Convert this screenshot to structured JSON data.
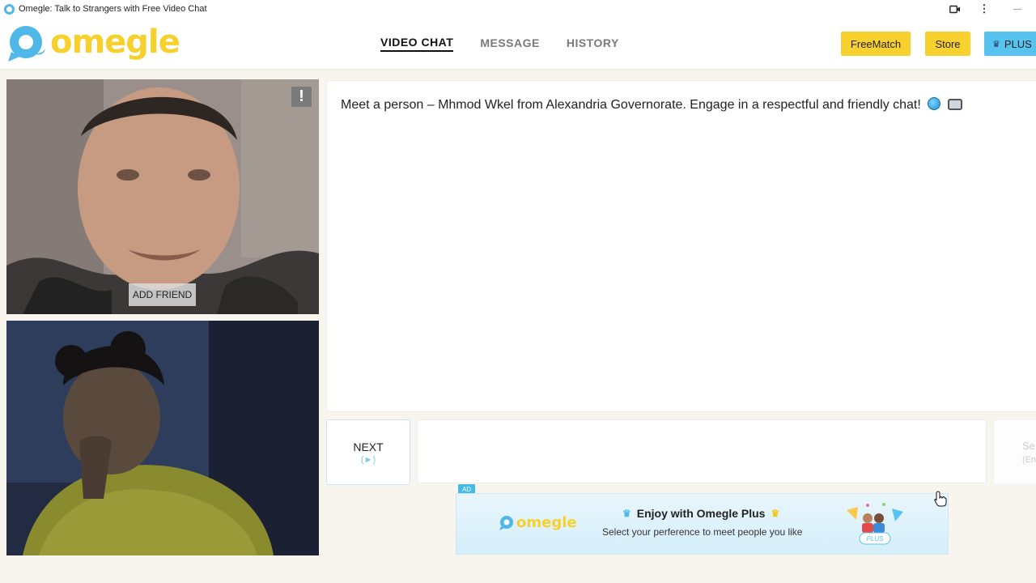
{
  "window": {
    "title": "Omegle: Talk to Strangers with Free Video Chat",
    "controls": {
      "camera": "camera-icon",
      "more": "⋮",
      "minimize": "—"
    }
  },
  "header": {
    "logo_text": "omegle",
    "nav": [
      {
        "label": "VIDEO CHAT",
        "active": true
      },
      {
        "label": "MESSAGE",
        "active": false
      },
      {
        "label": "HISTORY",
        "active": false
      }
    ],
    "freematch_label": "FreeMatch",
    "store_label": "Store",
    "plus_label": "PLUS",
    "plus_icon": "♛"
  },
  "video": {
    "remote": {
      "report_label": "!",
      "add_friend_label": "ADD FRIEND"
    }
  },
  "chat": {
    "intro_message": "Meet a person – Mhmod Wkel from Alexandria Governorate. Engage in a respectful and friendly chat!"
  },
  "controls": {
    "next_label": "NEXT",
    "next_hint": "(►)",
    "input_value": "",
    "send_label": "Se",
    "send_hint": "(En"
  },
  "ad": {
    "tag": "AD",
    "logo_text": "omegle",
    "title": "Enjoy with Omegle Plus",
    "subtitle": "Select your perference to meet people you like",
    "badge_text": "PLUS"
  },
  "colors": {
    "accent_yellow": "#f9d12e",
    "accent_blue": "#58c3ef",
    "page_bg": "#f8f4ee"
  }
}
